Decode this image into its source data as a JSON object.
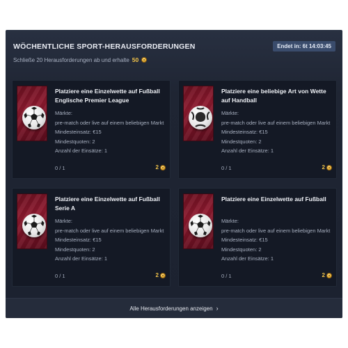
{
  "header": {
    "title": "Wöchentliche Sport-Herausforderungen",
    "subtitle": "Schließe 20 Herausforderungen ab und erhalte",
    "reward": "50",
    "reward_icon": "coin-icon",
    "timer": "Endet in: 6t 14:03:45"
  },
  "cards": [
    {
      "title": "Platziere eine Einzelwette auf Fußball Englische Premier League",
      "markets_label": "Märkte:",
      "markets_value": "pre-match oder live auf einem beliebigen Markt",
      "min_stake": "Mindesteinsatz: €15",
      "min_odds": "Mindestquoten: 2",
      "bets_count": "Anzahl der Einsätze: 1",
      "progress": "0 / 1",
      "reward": "2",
      "image": "football-icon"
    },
    {
      "title": "Platziere eine beliebige Art von Wette auf Handball",
      "markets_label": "Märkte:",
      "markets_value": "pre-match oder live auf einem beliebigen Markt",
      "min_stake": "Mindesteinsatz: €15",
      "min_odds": "Mindestquoten: 2",
      "bets_count": "Anzahl der Einsätze: 1",
      "progress": "0 / 1",
      "reward": "2",
      "image": "handball-icon"
    },
    {
      "title": "Platziere eine Einzelwette auf Fußball Serie A",
      "markets_label": "Märkte:",
      "markets_value": "pre-match oder live auf einem beliebigen Markt",
      "min_stake": "Mindesteinsatz: €15",
      "min_odds": "Mindestquoten: 2",
      "bets_count": "Anzahl der Einsätze: 1",
      "progress": "0 / 1",
      "reward": "2",
      "image": "football-icon"
    },
    {
      "title": "Platziere eine Einzelwette auf Fußball",
      "markets_label": "Märkte:",
      "markets_value": "pre-match oder live auf einem beliebigen Markt",
      "min_stake": "Mindesteinsatz: €15",
      "min_odds": "Mindestquoten: 2",
      "bets_count": "Anzahl der Einsätze: 1",
      "progress": "0 / 1",
      "reward": "2",
      "image": "football-icon"
    }
  ],
  "footer": {
    "label": "Alle Herausforderungen anzeigen",
    "icon": "chevron-right-icon"
  },
  "colors": {
    "panel": "#1e2431",
    "card": "#141925",
    "accent_gold": "#f2c44a",
    "card_art": "#8e1a2f",
    "timer_badge": "#3a4c6c"
  }
}
